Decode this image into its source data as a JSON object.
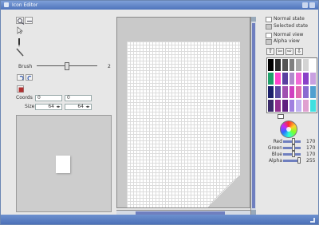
{
  "window": {
    "title": "Icon Editor"
  },
  "tools": {
    "items": [
      {
        "name": "zoom-in-tool-button",
        "icon": "zoom-in-icon"
      },
      {
        "name": "zoom-out-tool-button",
        "icon": "zoom-out-icon"
      },
      {
        "name": "select-tool-button",
        "icon": "select-icon"
      },
      {
        "name": "pencil-tool-button",
        "icon": "pencil-icon"
      },
      {
        "name": "line-tool-button",
        "icon": "line-icon"
      },
      {
        "name": "undo-button",
        "icon": "undo-icon"
      },
      {
        "name": "redo-button",
        "icon": "redo-icon"
      },
      {
        "name": "eraser-button",
        "icon": "eraser-icon"
      }
    ]
  },
  "brush": {
    "label": "Brush",
    "value": "2"
  },
  "coords": {
    "label": "Coords",
    "x": "0",
    "y": "0"
  },
  "size": {
    "label": "Size",
    "width": "64",
    "height": "64"
  },
  "view_options": {
    "normal_state": "Normal state",
    "selected_state": "Selected state",
    "normal_view": "Normal view",
    "alpha_view": "Alpha view"
  },
  "palette": {
    "colors": [
      "#000000",
      "#2b2b2b",
      "#555555",
      "#808080",
      "#aaaaaa",
      "#d4d4d4",
      "#ffffff",
      "#1fa06a",
      "#ff44cc",
      "#5a3fa0",
      "#b08acb",
      "#f06ad6",
      "#8a40c8",
      "#c8a0e0",
      "#1c1f6a",
      "#5a4aa0",
      "#a050b0",
      "#d040c0",
      "#e06ab0",
      "#8a6ad0",
      "#50a0d0",
      "#3a2a6a",
      "#903090",
      "#602080",
      "#a080e0",
      "#c0b0f0",
      "#e0a0d0",
      "#40e0e0"
    ],
    "selected": "#ffffff"
  },
  "color_sliders": [
    {
      "label": "Red",
      "value": "170"
    },
    {
      "label": "Green",
      "value": "170"
    },
    {
      "label": "Blue",
      "value": "170"
    },
    {
      "label": "Alpha",
      "value": "255"
    }
  ],
  "navigation": {
    "up": "⇧",
    "left": "⇦",
    "right": "⇨",
    "down": "⇩"
  },
  "levels": {
    "brush": 0.5,
    "red": 0.67,
    "green": 0.67,
    "blue": 0.67,
    "alpha": 1.0
  }
}
